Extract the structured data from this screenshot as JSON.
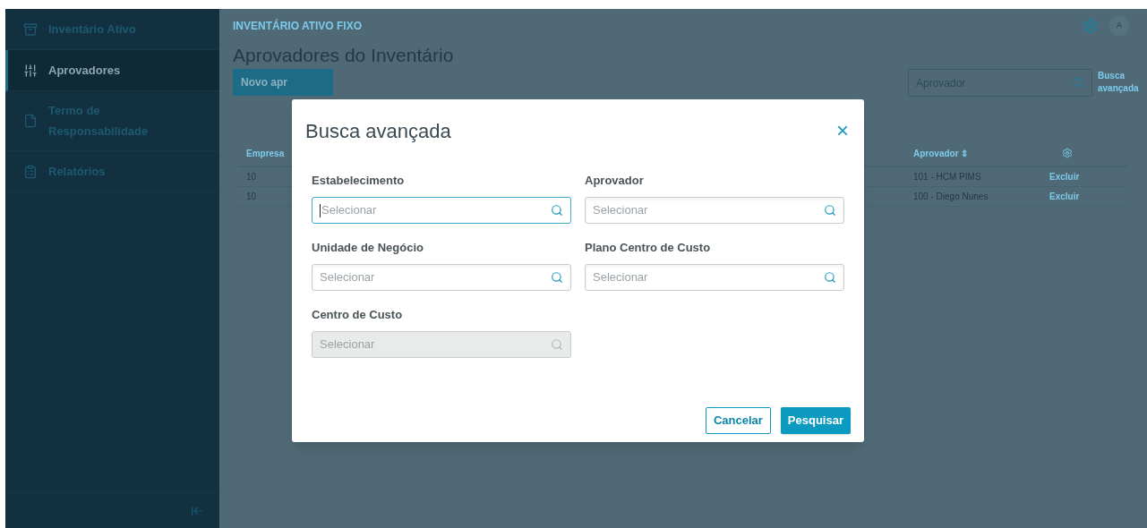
{
  "sidebar": {
    "items": [
      {
        "label": "Inventário Ativo",
        "selected": false
      },
      {
        "label": "Aprovadores",
        "selected": true
      },
      {
        "label": "Termo de Responsabilidade",
        "selected": false
      },
      {
        "label": "Relatórios",
        "selected": false
      }
    ]
  },
  "header": {
    "title": "INVENTÁRIO ATIVO FIXO",
    "avatar": "A"
  },
  "page": {
    "title": "Aprovadores do Inventário",
    "new_button": "Novo apr",
    "search": {
      "placeholder": "Aprovador"
    },
    "advanced_link": "Busca avançada"
  },
  "table": {
    "columns": [
      "Empresa",
      "Aprovador ⇕"
    ],
    "rows": [
      {
        "empresa": "10",
        "aprovador": "101 - HCM PIMS",
        "action": "Excluir"
      },
      {
        "empresa": "10",
        "aprovador": "100 - Diego Nunes",
        "action": "Excluir"
      }
    ]
  },
  "dialog": {
    "title": "Busca avançada",
    "close": "×",
    "fields": [
      {
        "label": "Estabelecimento",
        "placeholder": "Selecionar",
        "focused": true,
        "disabled": false
      },
      {
        "label": "Aprovador",
        "placeholder": "Selecionar",
        "focused": false,
        "disabled": false
      },
      {
        "label": "Unidade de Negócio",
        "placeholder": "Selecionar",
        "focused": false,
        "disabled": false
      },
      {
        "label": "Plano Centro de Custo",
        "placeholder": "Selecionar",
        "focused": false,
        "disabled": false
      },
      {
        "label": "Centro de Custo",
        "placeholder": "Selecionar",
        "focused": false,
        "disabled": true
      }
    ],
    "buttons": [
      {
        "label": "Cancelar",
        "kind": "secondary"
      },
      {
        "label": "Pesquisar",
        "kind": "primary"
      }
    ]
  }
}
